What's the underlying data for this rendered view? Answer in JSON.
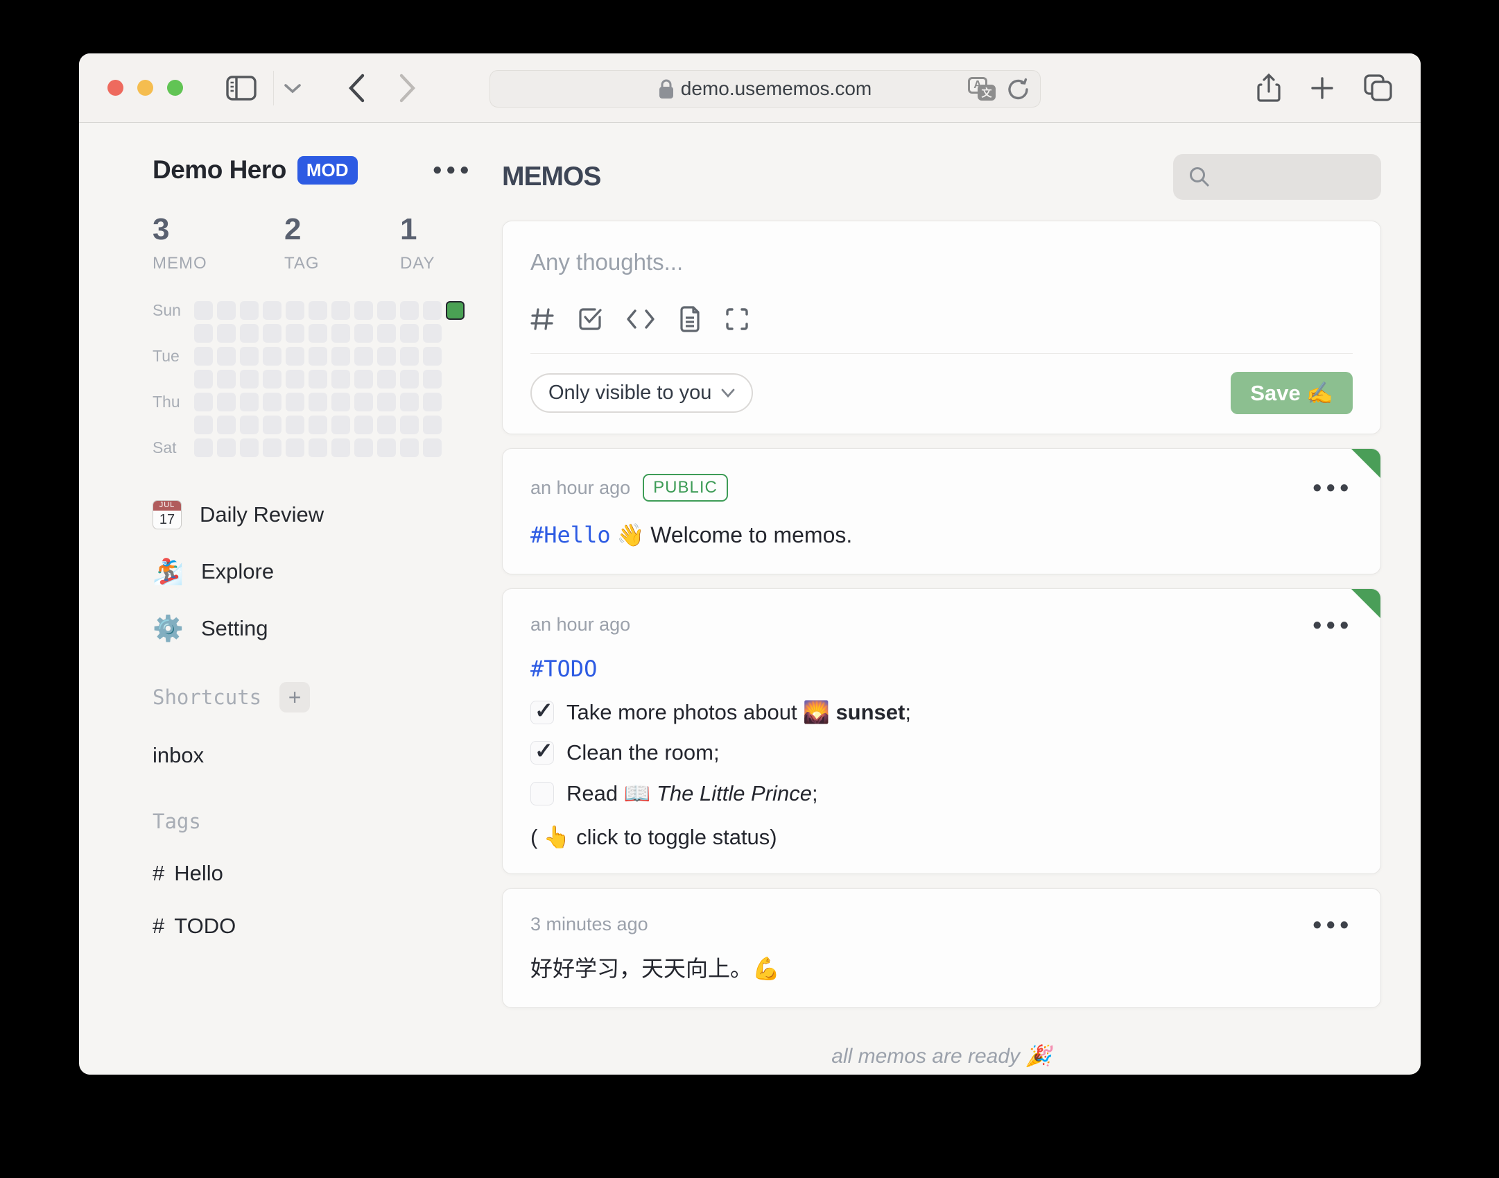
{
  "browser": {
    "url": "demo.usememos.com",
    "translate_letter_a": "A",
    "translate_letter_cjk": "文"
  },
  "colors": {
    "accent_blue": "#2d5be3",
    "save_green": "#8cbf90",
    "badge_green": "#3e9c57",
    "pin_green": "#4a9e58",
    "heatmap_today_green": "#4aa154"
  },
  "sidebar": {
    "user": {
      "name": "Demo Hero",
      "badge": "MOD"
    },
    "stats": [
      {
        "value": "3",
        "label": "MEMO"
      },
      {
        "value": "2",
        "label": "TAG"
      },
      {
        "value": "1",
        "label": "DAY"
      }
    ],
    "heatmap": {
      "day_labels": [
        "Sun",
        "",
        "Tue",
        "",
        "Thu",
        "",
        "Sat"
      ],
      "columns": 12,
      "rows": 7,
      "short_last_column": true,
      "active_cell": {
        "row": 0,
        "col": 11
      },
      "active_color": "#4aa154",
      "cell_color": "#e9e9ec"
    },
    "nav": [
      {
        "icon": "calendar",
        "label": "Daily Review",
        "calendar_month": "JUL",
        "calendar_day": "17"
      },
      {
        "icon": "snowboarder",
        "label": "Explore",
        "emoji": "🏂"
      },
      {
        "icon": "gear",
        "label": "Setting",
        "emoji": "⚙️"
      }
    ],
    "shortcuts_title": "Shortcuts",
    "add_shortcut_label": "+",
    "shortcut_items": [
      "inbox"
    ],
    "tags_title": "Tags",
    "tag_hash": "#",
    "tags": [
      "Hello",
      "TODO"
    ]
  },
  "main": {
    "title": "MEMOS",
    "editor": {
      "placeholder": "Any thoughts...",
      "visibility": "Only visible to you",
      "save_label": "Save ✍️"
    },
    "memos": [
      {
        "time": "an hour ago",
        "badge": "PUBLIC",
        "pinned": true,
        "tag": "#Hello",
        "content": "👋 Welcome to memos."
      },
      {
        "time": "an hour ago",
        "pinned": true,
        "tag": "#TODO",
        "tasks": [
          {
            "checked": true,
            "text": "Take more photos about 🌄 ",
            "bold": "sunset",
            "suffix": ";"
          },
          {
            "checked": true,
            "text": "Clean the room;"
          },
          {
            "checked": false,
            "text": "Read 📖 ",
            "italic": "The Little Prince",
            "suffix": ";"
          }
        ],
        "note": "( 👆 click to toggle status)"
      },
      {
        "time": "3 minutes ago",
        "pinned": false,
        "content": "好好学习，天天向上。💪"
      }
    ],
    "footer": "all memos are ready 🎉"
  }
}
